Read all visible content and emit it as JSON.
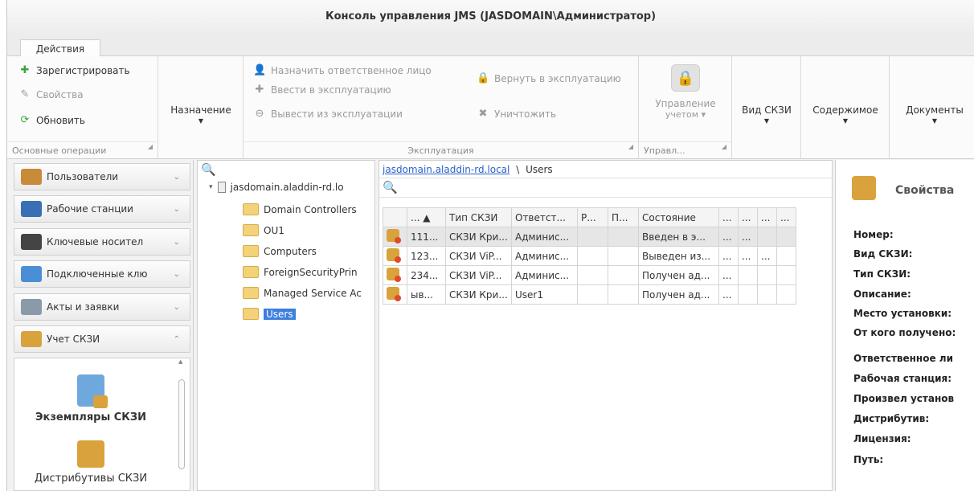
{
  "window": {
    "title": "Консоль управления JMS (JASDOMAIN\\Администратор)"
  },
  "ribbon": {
    "tab": "Действия",
    "groups": {
      "main_ops": {
        "caption": "Основные операции",
        "register": "Зарегистрировать",
        "properties": "Свойства",
        "refresh": "Обновить"
      },
      "assign": "Назначение",
      "exploitation": {
        "caption": "Эксплуатация",
        "assign_responsible": "Назначить ответственное лицо",
        "put_into_service": "Ввести в эксплуатацию",
        "remove_from_service": "Вывести из эксплуатации",
        "return_to_service": "Вернуть в эксплуатацию",
        "destroy": "Уничтожить"
      },
      "accounting": {
        "label1": "Управление",
        "label2": "учетом",
        "caption": "Управл..."
      },
      "type": "Вид СКЗИ",
      "content": "Содержимое",
      "documents": "Документы"
    }
  },
  "nav": {
    "items": [
      "Пользователи",
      "Рабочие станции",
      "Ключевые носител",
      "Подключенные клю",
      "Акты и заявки",
      "Учет СКЗИ"
    ],
    "panel_items": [
      "Экземпляры СКЗИ",
      "Дистрибутивы СКЗИ"
    ]
  },
  "tree": {
    "root": "jasdomain.aladdin-rd.lo",
    "children": [
      "Domain Controllers",
      "OU1",
      "Computers",
      "ForeignSecurityPrin",
      "Managed Service Ac",
      "Users"
    ],
    "selected_index": 5
  },
  "grid": {
    "breadcrumb_link": "jasdomain.aladdin-rd.local",
    "breadcrumb_sep": "\\",
    "breadcrumb_current": "Users",
    "columns": [
      "... ▲",
      "Тип СКЗИ",
      "Ответст...",
      "Р...",
      "П...",
      "Состояние",
      "...",
      "...",
      "...",
      "..."
    ],
    "rows": [
      [
        "111...",
        "СКЗИ Кри...",
        "Админис...",
        "",
        "",
        "Введен в э...",
        "...",
        "...",
        "",
        ""
      ],
      [
        "123...",
        "СКЗИ ViP...",
        "Админис...",
        "",
        "",
        "Выведен из...",
        "...",
        "...",
        "...",
        ""
      ],
      [
        "234...",
        "СКЗИ ViP...",
        "Админис...",
        "",
        "",
        "Получен ад...",
        "...",
        "",
        "",
        ""
      ],
      [
        "ыв...",
        "СКЗИ Кри...",
        "User1",
        "",
        "",
        "Получен ад...",
        "...",
        "",
        "",
        ""
      ]
    ]
  },
  "props": {
    "title": "Свойства",
    "labels": [
      "Номер:",
      "Вид СКЗИ:",
      "Тип СКЗИ:",
      "Описание:",
      "Место установки:",
      "От кого получено:",
      "Ответственное ли",
      "Рабочая станция:",
      "Произвел установ",
      "Дистрибутив:",
      "Лицензия:",
      "Путь:"
    ]
  }
}
